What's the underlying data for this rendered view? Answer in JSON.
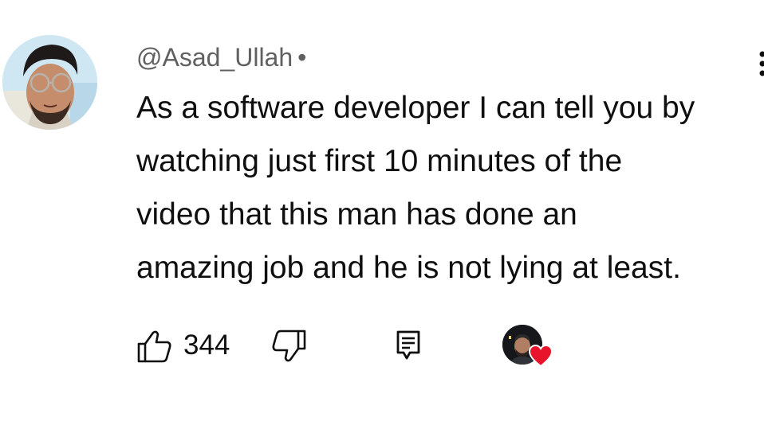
{
  "comment": {
    "author": "@Asad_Ullah",
    "separator": "•",
    "body_lines": [
      "As a software developer I can tell you by",
      "watching just first 10 minutes of the",
      "video that this man has done an",
      "amazing job and he is not lying at least."
    ],
    "like_count": "344",
    "hearted_by_creator": true
  },
  "icons": {
    "avatar": "user-avatar",
    "more": "vertical-ellipsis-icon",
    "like": "thumbs-up-icon",
    "dislike": "thumbs-down-icon",
    "reply": "reply-comment-icon",
    "creator_avatar": "creator-avatar",
    "heart": "heart-icon"
  },
  "colors": {
    "text_primary": "#0f0f0f",
    "text_secondary": "#606060",
    "heart": "#e8142c"
  }
}
